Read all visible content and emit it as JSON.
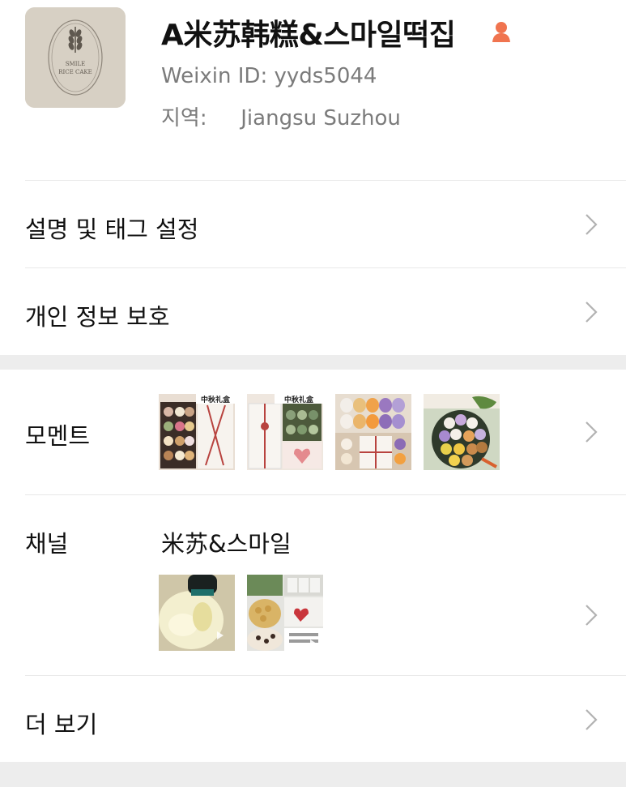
{
  "profile": {
    "name": "A米苏韩糕&스마일떡집",
    "wxid": "Weixin ID: yyds5044",
    "region_label": "지역:",
    "region_value": "Jiangsu  Suzhou",
    "avatar_text": [
      "SMILE",
      "RICE CAKE"
    ],
    "gender_color": "#f0744f"
  },
  "menu": {
    "tags": "설명 및 태그 설정",
    "privacy": "개인 정보 보호",
    "moments": "모멘트",
    "channel": "채널",
    "channel_name": "米苏&스마일",
    "more": "더 보기"
  },
  "moments_thumbs": [
    {
      "caption": "中秋礼盒",
      "kind": "gift-box"
    },
    {
      "caption": "中秋礼盒",
      "kind": "gift-box-heart"
    },
    {
      "caption": "",
      "kind": "colorful-cakes"
    },
    {
      "caption": "",
      "kind": "plate-cakes"
    }
  ],
  "channel_thumbs": [
    {
      "kind": "video-bowl"
    },
    {
      "kind": "video-collage"
    }
  ],
  "colors": {
    "chevron": "#b2b2b2",
    "divider": "#e8e8e8",
    "section_gap": "#ededed",
    "secondary_text": "#7b7b7b"
  }
}
